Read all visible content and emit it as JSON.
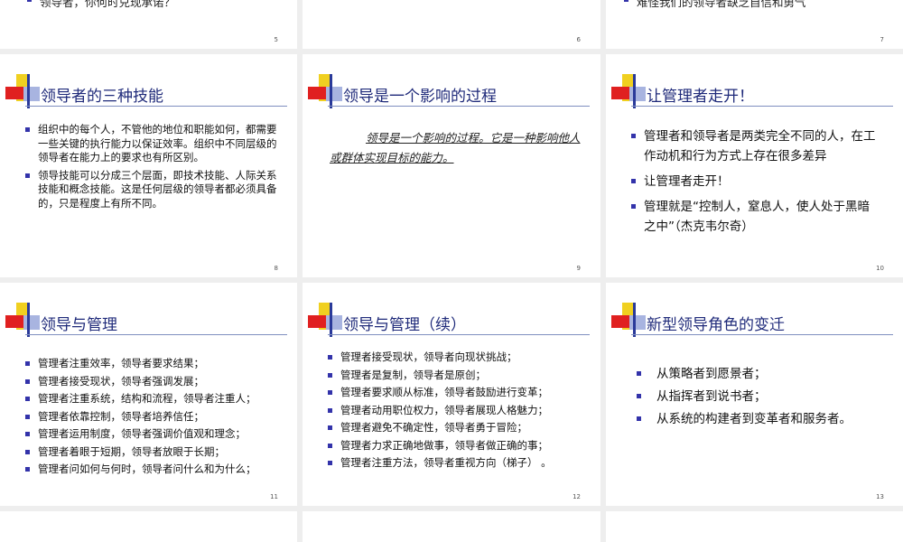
{
  "top_row": {
    "s5": {
      "bullet": "领导者，你何时兑现承诺？",
      "num": "5"
    },
    "s6": {
      "num": "6"
    },
    "s7": {
      "bullet": "难怪我们的领导者缺乏自信和勇气",
      "num": "7"
    }
  },
  "slides": {
    "s8": {
      "title": "领导者的三种技能",
      "bullets": [
        "组织中的每个人，不管他的地位和职能如何，都需要一些关键的执行能力以保证效率。组织中不同层级的领导者在能力上的要求也有所区别。",
        "领导技能可以分成三个层面，即技术技能、人际关系技能和概念技能。这是任何层级的领导者都必须具备的，只是程度上有所不同。"
      ],
      "num": "8"
    },
    "s9": {
      "title": "领导是一个影响的过程",
      "quote": "领导是一个影响的过程。它是一种影响他人或群体实现目标的能力。",
      "num": "9"
    },
    "s10": {
      "title": "让管理者走开！",
      "bullets": [
        "管理者和领导者是两类完全不同的人，在工作动机和行为方式上存在很多差异",
        "让管理者走开！",
        "管理就是“控制人，窒息人，使人处于黑暗之中”（杰克韦尔奇）"
      ],
      "num": "10"
    },
    "s11": {
      "title": "领导与管理",
      "bullets": [
        "管理者注重效率，领导者要求结果；",
        "管理者接受现状，领导者强调发展；",
        "管理者注重系统，结构和流程，领导者注重人；",
        "管理者依靠控制，领导者培养信任；",
        "管理者运用制度，领导者强调价值观和理念；",
        "管理者着眼于短期，领导者放眼于长期；",
        "管理者问如何与何时，领导者问什么和为什么；"
      ],
      "num": "11"
    },
    "s12": {
      "title": "领导与管理（续）",
      "bullets": [
        "管理者接受现状，领导者向现状挑战；",
        "管理者是复制，领导者是原创；",
        "管理者要求顺从标准，领导者鼓励进行变革；",
        "管理者动用职位权力，领导者展现人格魅力；",
        "管理者避免不确定性，领导者勇于冒险；",
        "管理者力求正确地做事，领导者做正确的事；",
        "管理者注重方法，领导者重视方向（梯子）  。"
      ],
      "num": "12"
    },
    "s13": {
      "title": "新型领导角色的变迁",
      "bullets": [
        "从策略者到愿景者；",
        "从指挥者到说书者；",
        "从系统的构建者到变革者和服务者。"
      ],
      "num": "13"
    }
  },
  "colors": {
    "title": "#1f2a7a",
    "bullet": "#3333aa",
    "logo_red": "#e02020",
    "logo_yellow": "#f0d020",
    "logo_blue": "#2a3a9a",
    "logo_lightblue": "#a8b4e0"
  }
}
